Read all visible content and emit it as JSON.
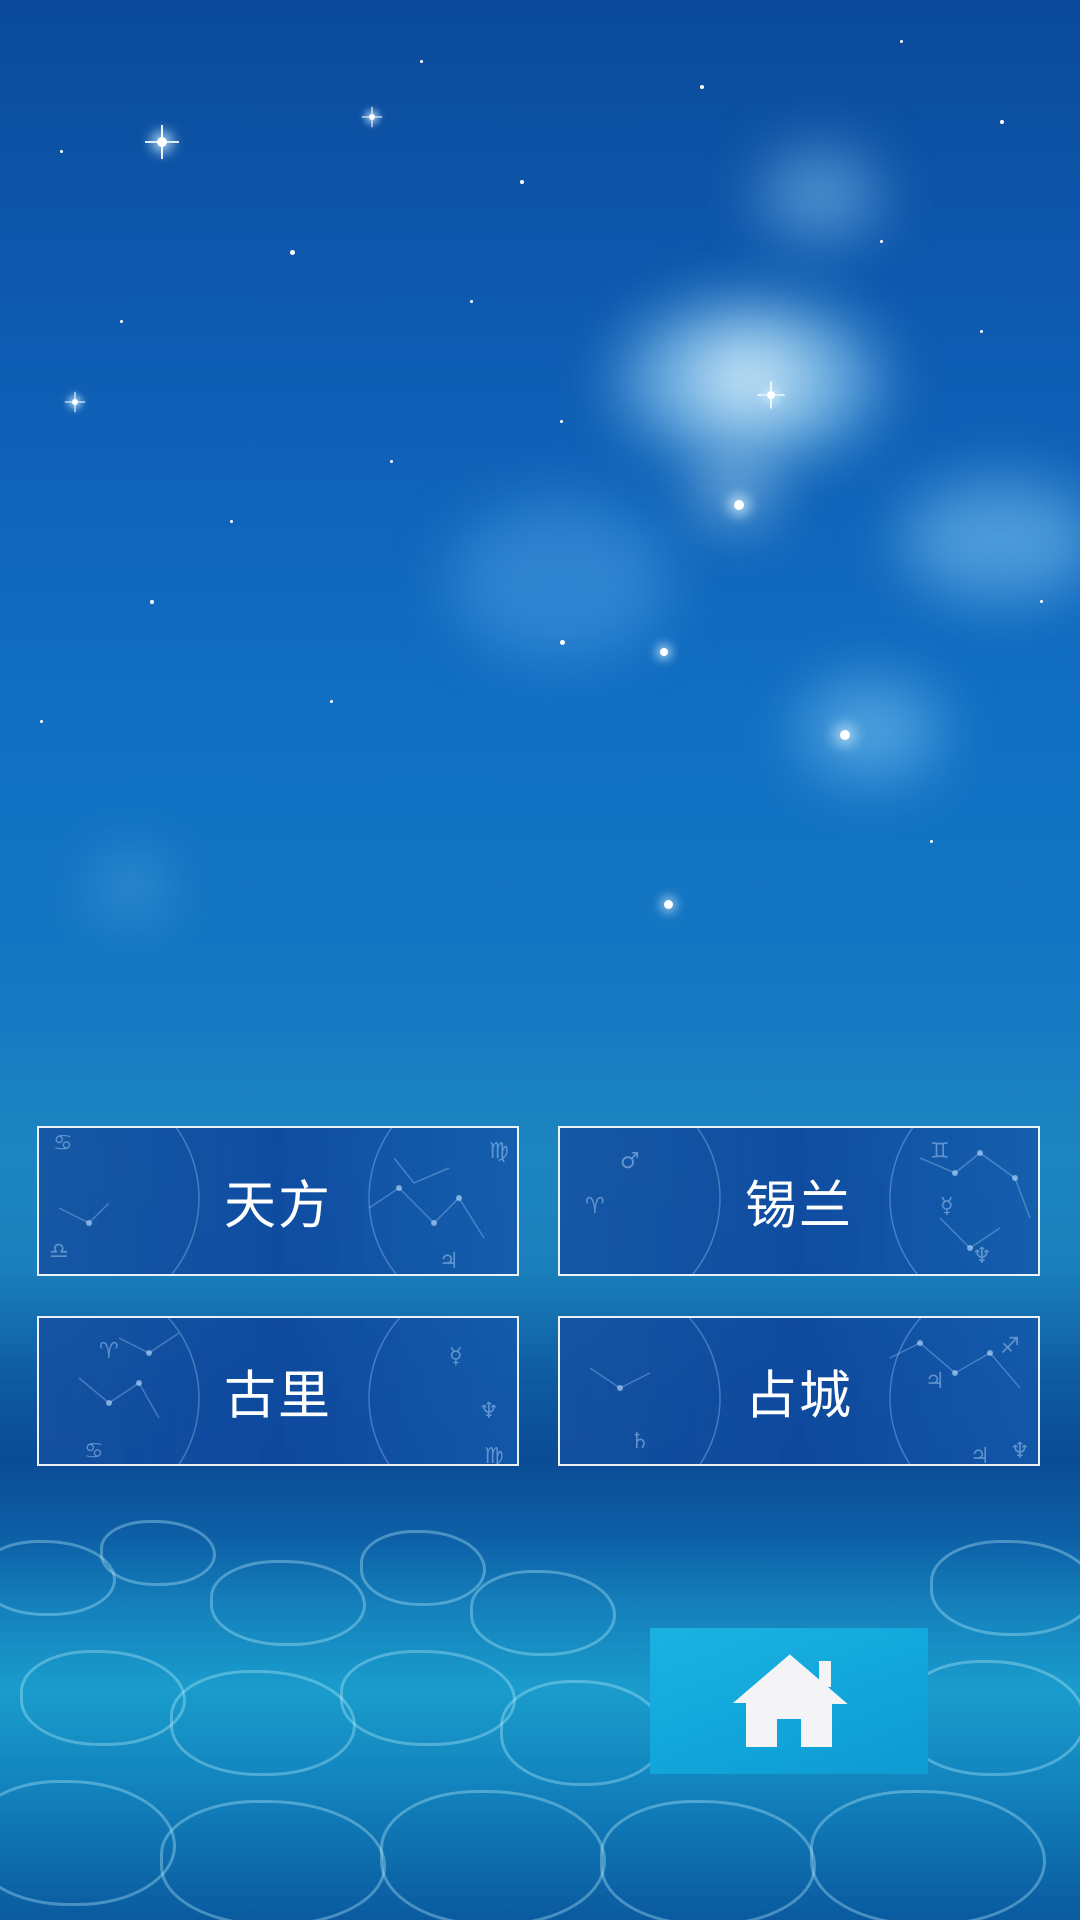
{
  "cities": [
    {
      "label": "天方"
    },
    {
      "label": "锡兰"
    },
    {
      "label": "古里"
    },
    {
      "label": "占城"
    }
  ],
  "home_button": {
    "icon": "home-icon"
  },
  "colors": {
    "button_border": "#ffffff",
    "button_fill": "#0e489e",
    "home_button_fill": "#11a6da",
    "home_icon": "#ffffff"
  }
}
